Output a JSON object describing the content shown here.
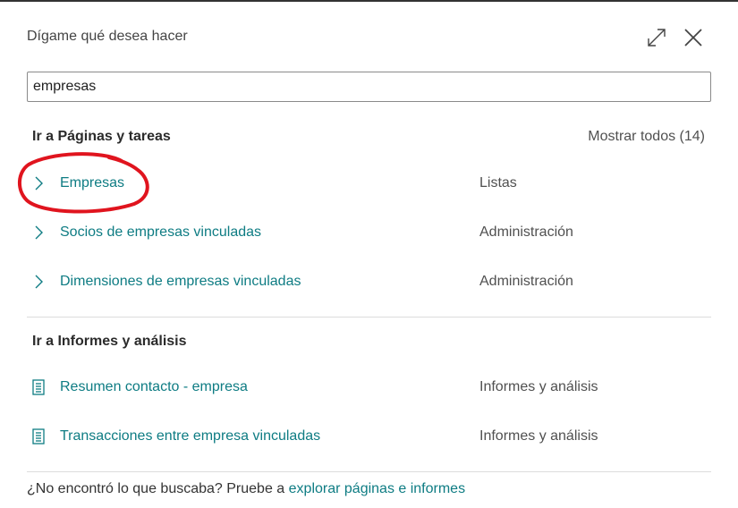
{
  "dialog": {
    "title": "Dígame qué desea hacer",
    "search_value": "empresas"
  },
  "pages_section": {
    "title": "Ir a Páginas y tareas",
    "show_all": "Mostrar todos (14)",
    "items": [
      {
        "label": "Empresas",
        "category": "Listas",
        "icon": "chevron-right-icon"
      },
      {
        "label": "Socios de empresas vinculadas",
        "category": "Administración",
        "icon": "chevron-right-icon"
      },
      {
        "label": "Dimensiones de empresas vinculadas",
        "category": "Administración",
        "icon": "chevron-right-icon"
      }
    ]
  },
  "reports_section": {
    "title": "Ir a Informes y análisis",
    "items": [
      {
        "label": "Resumen contacto - empresa",
        "category": "Informes y análisis",
        "icon": "report-icon"
      },
      {
        "label": "Transacciones entre empresa vinculadas",
        "category": "Informes y análisis",
        "icon": "report-icon"
      }
    ]
  },
  "footer": {
    "text": "¿No encontró lo que buscaba? Pruebe a ",
    "link": "explorar páginas e informes"
  },
  "colors": {
    "link": "#0e7c83",
    "annotation": "#e0141e"
  }
}
